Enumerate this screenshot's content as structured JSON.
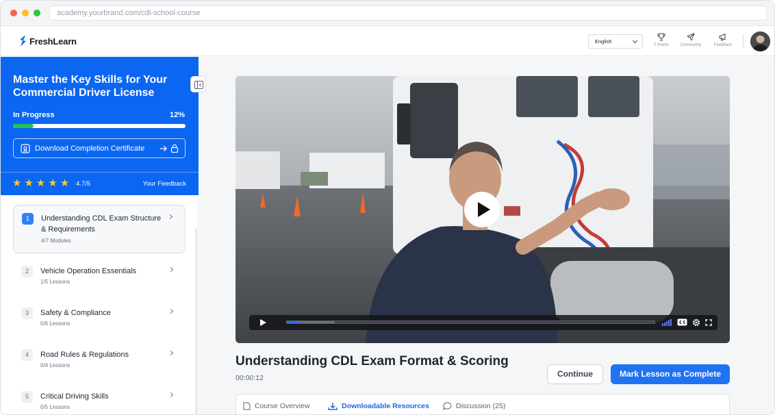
{
  "browser": {
    "url": "academy.yourbrand.com/cdl-school-course"
  },
  "header": {
    "brand": "FreshLearn",
    "language": "English",
    "points_label": "0 Points",
    "community_label": "Community",
    "feedback_label": "Feedback"
  },
  "course": {
    "title": "Master the Key Skills for Your Commercial Driver License",
    "progress_label": "In Progress",
    "progress_pct_text": "12%",
    "progress_value": 0.12,
    "certificate_label": "Download Completion Certificate",
    "rating": "4.7/5",
    "rating_stars": 5,
    "feedback_label": "Your Feedback"
  },
  "modules": [
    {
      "num": "1",
      "title": "Understanding CDL Exam Structure & Requirements",
      "sub": "4/7 Modules"
    },
    {
      "num": "2",
      "title": "Vehicle Operation Essentials",
      "sub": "1/5 Lessons"
    },
    {
      "num": "3",
      "title": "Safety & Compliance",
      "sub": "0/6 Lessons"
    },
    {
      "num": "4",
      "title": "Road Rules & Regulations",
      "sub": "0/4 Lessons"
    },
    {
      "num": "5",
      "title": "Critical Driving Skills",
      "sub": "0/5 Lessons"
    }
  ],
  "lesson": {
    "title": "Understanding CDL Exam Format & Scoring",
    "time": "00:00:12",
    "continue_label": "Continue",
    "complete_label": "Mark Lesson as Complete",
    "played_fraction": 0.035,
    "buffered_fraction": 0.13
  },
  "tabs": [
    {
      "label": "Course Overview",
      "icon": "document-icon"
    },
    {
      "label": "Downloadable Resources",
      "icon": "download-icon"
    },
    {
      "label": "Discussion (25)",
      "icon": "chat-icon"
    }
  ],
  "colors": {
    "primary": "#0b66f2",
    "accent": "#1f73f2",
    "progress": "#24c25e",
    "star": "#ffc928"
  }
}
